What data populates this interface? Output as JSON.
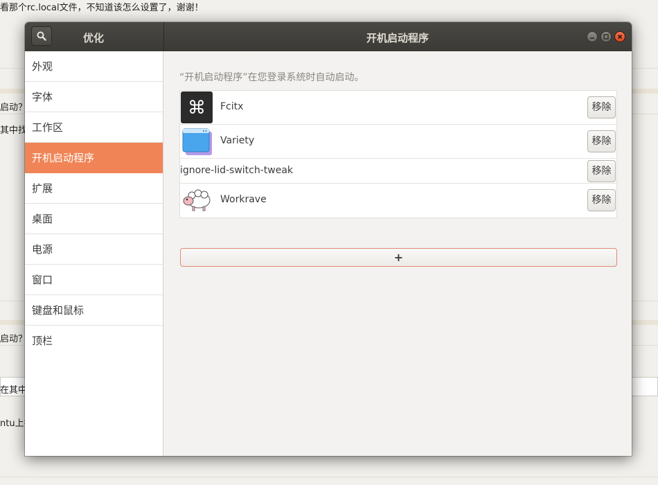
{
  "background": {
    "line1": "看那个rc.local文件，不知道该怎么设置了，谢谢！",
    "frag1": "启动？",
    "frag2": "其中找",
    "frag3": "启动？",
    "frag4": "在其中找",
    "frag5": "ntu上操"
  },
  "window": {
    "app_title": "优化",
    "page_title": "开机启动程序"
  },
  "sidebar": {
    "items": [
      {
        "label": "外观"
      },
      {
        "label": "字体"
      },
      {
        "label": "工作区"
      },
      {
        "label": "开机启动程序"
      },
      {
        "label": "扩展"
      },
      {
        "label": "桌面"
      },
      {
        "label": "电源"
      },
      {
        "label": "窗口"
      },
      {
        "label": "键盘和鼠标"
      },
      {
        "label": "顶栏"
      }
    ],
    "selected_index": 3
  },
  "main": {
    "hint": "“开机启动程序”在您登录系统时自动启动。",
    "apps": [
      {
        "name": "Fcitx",
        "icon": "fcitx-command-icon",
        "remove_label": "移除"
      },
      {
        "name": "Variety",
        "icon": "variety-window-icon",
        "remove_label": "移除"
      },
      {
        "name": "ignore-lid-switch-tweak",
        "icon": "",
        "remove_label": "移除"
      },
      {
        "name": "Workrave",
        "icon": "workrave-sheep-icon",
        "remove_label": "移除"
      }
    ],
    "add_label": "+"
  },
  "colors": {
    "accent": "#f08456",
    "titlebar": "#3f3e3a",
    "close_button": "#e35b35"
  }
}
